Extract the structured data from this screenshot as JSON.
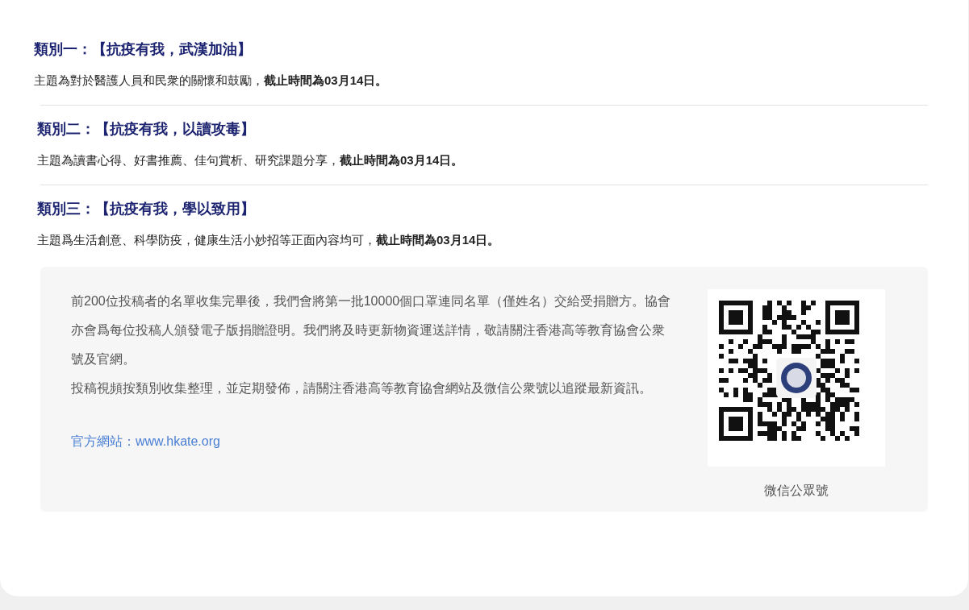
{
  "categories": [
    {
      "title": "類別一：【抗疫有我，武漢加油】",
      "description": "主題為對於醫護人員和民衆的關懷和鼓勵，**截止時間為03月14日。**"
    },
    {
      "title": "類別二：【抗疫有我，以讀攻毒】",
      "description": "主題為讀書心得、好書推薦、佳句賞析、研究課題分享，**截止時間為03月14日。**"
    },
    {
      "title": "類別三：【抗疫有我，學以致用】",
      "description": "主題爲生活創意、科學防疫，健康生活小妙招等正面內容均可，**截止時間為03月14日。**"
    }
  ],
  "notice": {
    "paragraphs": [
      "前200位投稿者的名單收集完畢後，我們會將第一批10000個口罩連同名單（僅姓名）交給受捐贈方。協會亦會爲每位投稿人頒發電子版捐贈證明。我們將及時更新物資運送詳情，敬請關注香港高等教育協會公衆號及官網。",
      "投稿視頻按類別收集整理，並定期發佈，請關注香港高等教育協會網站及微信公衆號以追蹤最新資訊。"
    ],
    "website": "官方網站：www.hkate.org",
    "qr_caption": "微信公眾號"
  }
}
